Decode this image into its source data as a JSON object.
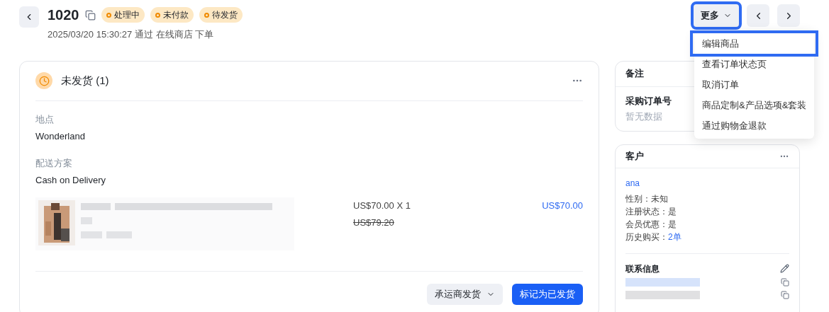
{
  "header": {
    "order_number": "1020",
    "badges": [
      "处理中",
      "未付款",
      "待发货"
    ],
    "subtitle": "2025/03/20 15:30:27 通过 在线商店 下单"
  },
  "more_button": {
    "label": "更多",
    "highlighted": true
  },
  "more_menu": [
    {
      "label": "编辑商品",
      "highlighted": true
    },
    {
      "label": "查看订单状态页",
      "highlighted": false
    },
    {
      "label": "取消订单",
      "highlighted": false
    },
    {
      "label": "商品定制&产品选项&套装",
      "highlighted": false
    },
    {
      "label": "通过购物金退款",
      "highlighted": false
    }
  ],
  "fulfillment": {
    "title": "未发货 (1)",
    "location_label": "地点",
    "location": "Wonderland",
    "shipping_label": "配送方案",
    "shipping": "Cash on Delivery",
    "item": {
      "kind": "picture",
      "unit_price": "US$70.00 X 1",
      "original_price": "US$79.20",
      "total": "US$70.00"
    },
    "carrier_button": "承运商发货",
    "mark_button": "标记为已发货"
  },
  "notes": {
    "title": "备注",
    "po_label": "采购订单号",
    "po_value": "暂无数据"
  },
  "customer": {
    "title": "客户",
    "name": "ana",
    "fields": [
      {
        "label": "性别：",
        "value": "未知",
        "link": false
      },
      {
        "label": "注册状态：",
        "value": "是",
        "link": false
      },
      {
        "label": "会员优惠：",
        "value": "是",
        "link": false
      },
      {
        "label": "历史购买：",
        "value": "2单",
        "link": true
      }
    ],
    "contact_title": "联系信息"
  }
}
